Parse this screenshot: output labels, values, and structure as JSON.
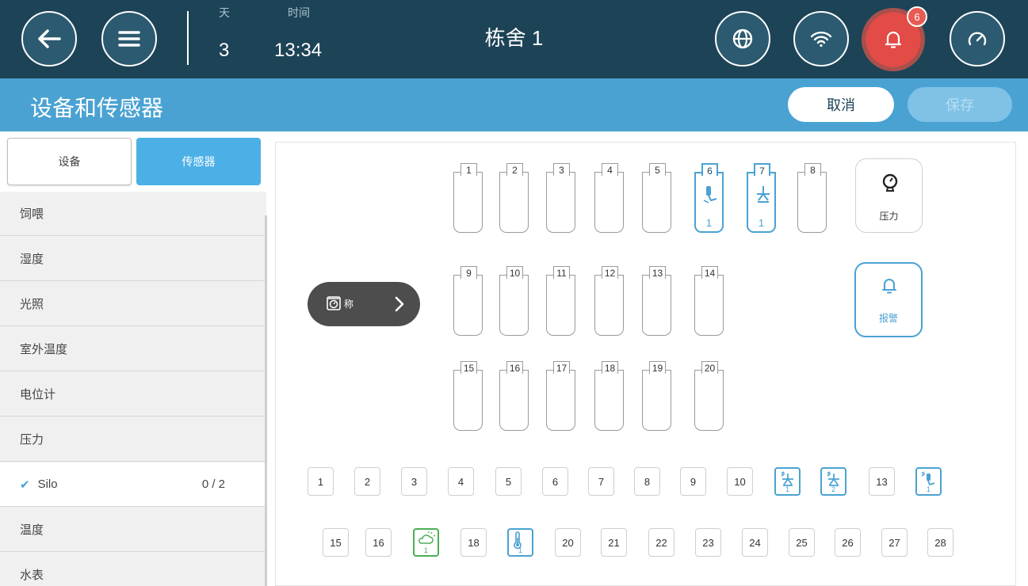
{
  "header": {
    "day_label": "天",
    "day_value": "3",
    "time_label": "时间",
    "time_value": "13:34",
    "house_name": "栋舍 1",
    "alarm_count": "6"
  },
  "page": {
    "title": "设备和传感器",
    "cancel_label": "取消",
    "save_label": "保存"
  },
  "sidebar": {
    "tabs": {
      "devices": "设备",
      "sensors": "传感器"
    },
    "items": [
      {
        "label": "饲喂"
      },
      {
        "label": "湿度"
      },
      {
        "label": "光照"
      },
      {
        "label": "室外温度"
      },
      {
        "label": "电位计"
      },
      {
        "label": "压力"
      },
      {
        "label": "Silo",
        "count": "0 / 2",
        "check": "✔",
        "active": true
      },
      {
        "label": "温度"
      },
      {
        "label": "水表"
      }
    ]
  },
  "main": {
    "silos": [
      {
        "n": "1"
      },
      {
        "n": "2"
      },
      {
        "n": "3"
      },
      {
        "n": "4"
      },
      {
        "n": "5"
      },
      {
        "n": "6",
        "sub": "1",
        "icon": "feeder-icon"
      },
      {
        "n": "7",
        "sub": "1",
        "icon": "sprinkler-icon"
      },
      {
        "n": "8"
      },
      {
        "n": "9"
      },
      {
        "n": "10"
      },
      {
        "n": "11"
      },
      {
        "n": "12"
      },
      {
        "n": "13"
      },
      {
        "n": "14"
      },
      {
        "n": "15"
      },
      {
        "n": "16"
      },
      {
        "n": "17"
      },
      {
        "n": "18"
      },
      {
        "n": "19"
      },
      {
        "n": "20"
      }
    ],
    "scale_label": "称",
    "pressure_label": "压力",
    "alarm_label": "报警",
    "digital_row1": [
      {
        "n": "1"
      },
      {
        "n": "2"
      },
      {
        "n": "3"
      },
      {
        "n": "4"
      },
      {
        "n": "5"
      },
      {
        "n": "6"
      },
      {
        "n": "7"
      },
      {
        "n": "8"
      },
      {
        "n": "9"
      },
      {
        "n": "10"
      },
      {
        "n": "",
        "sub": "1",
        "icon": "mister-icon"
      },
      {
        "n": "",
        "sub": "2",
        "icon": "mister-icon"
      },
      {
        "n": "13"
      },
      {
        "n": "",
        "sub": "1",
        "icon": "feeder-icon"
      }
    ],
    "digital_row2": [
      {
        "n": "15"
      },
      {
        "n": "16"
      },
      {
        "n": "",
        "sub": "1",
        "icon": "weather-icon"
      },
      {
        "n": "18"
      },
      {
        "n": "",
        "sub": "1",
        "icon": "thermometer-icon"
      },
      {
        "n": "20"
      },
      {
        "n": "21"
      },
      {
        "n": "22"
      },
      {
        "n": "23"
      },
      {
        "n": "24"
      },
      {
        "n": "25"
      },
      {
        "n": "26"
      },
      {
        "n": "27"
      },
      {
        "n": "28"
      }
    ]
  },
  "colors": {
    "topbar": "#1d4356",
    "accent": "#4aa2d2",
    "alarm": "#e24b46",
    "green": "#4cae55"
  }
}
